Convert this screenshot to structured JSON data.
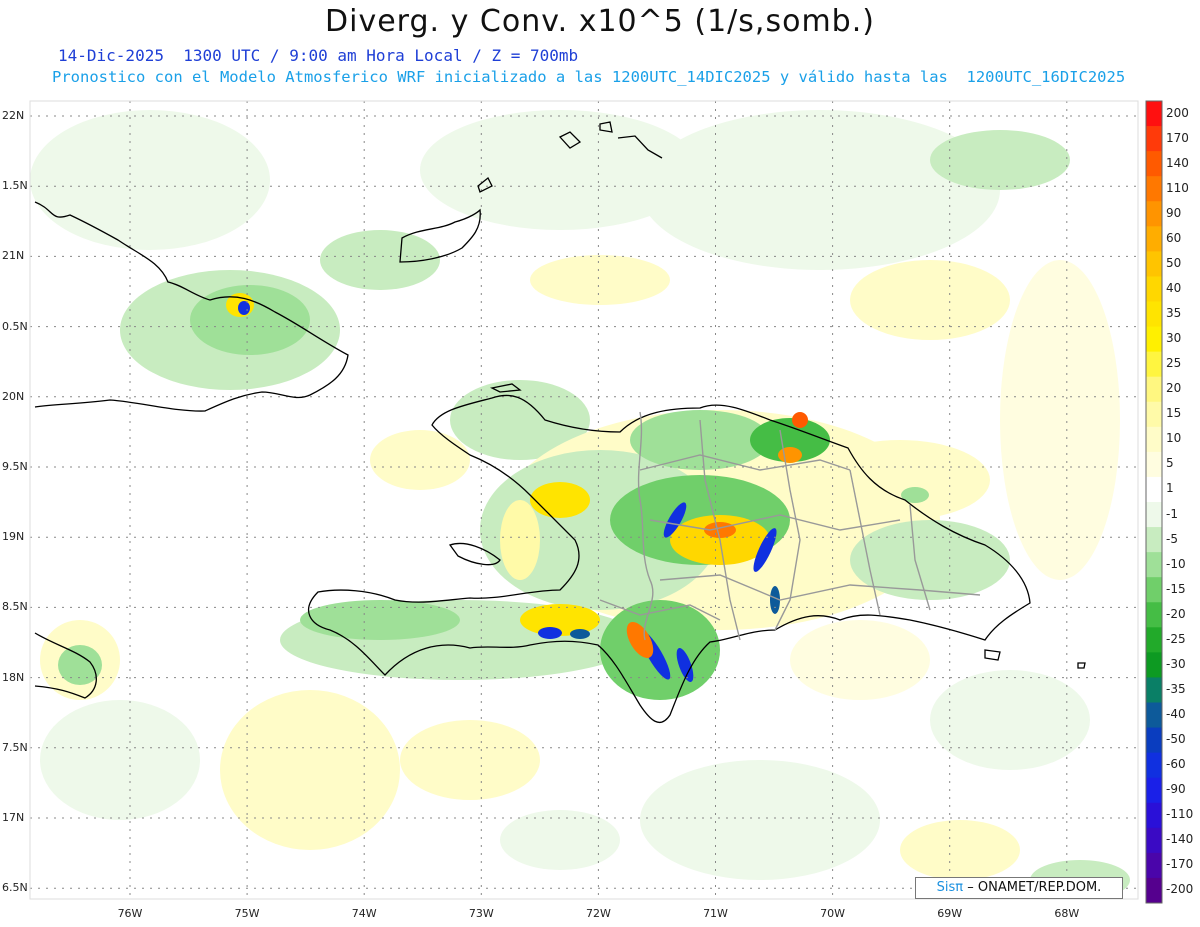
{
  "title": "Diverg. y Conv. x10^5 (1/s,somb.)",
  "subtitle_date": "14-Dic-2025  1300 UTC / 9:00 am Hora Local / Z = 700mb",
  "subtitle_model": "Pronostico con el Modelo Atmosferico WRF inicializado a las 1200UTC_14DIC2025 y válido hasta las  1200UTC_16DIC2025",
  "credit": {
    "brand": "Sisπ",
    "org": "– ONAMET/REP.DOM."
  },
  "lat_labels": [
    "22N",
    "1.5N",
    "21N",
    "0.5N",
    "20N",
    "9.5N",
    "19N",
    "8.5N",
    "18N",
    "7.5N",
    "17N",
    "6.5N"
  ],
  "lon_labels": [
    "76W",
    "75W",
    "74W",
    "73W",
    "72W",
    "71W",
    "70W",
    "69W",
    "68W"
  ],
  "colorbar": {
    "labels": [
      "200",
      "170",
      "140",
      "110",
      "90",
      "60",
      "50",
      "40",
      "35",
      "30",
      "25",
      "20",
      "15",
      "10",
      "5",
      "1",
      "-1",
      "-5",
      "-10",
      "-15",
      "-20",
      "-25",
      "-30",
      "-35",
      "-40",
      "-50",
      "-60",
      "-90",
      "-110",
      "-140",
      "-170",
      "-200"
    ],
    "colors": [
      "#ff1010",
      "#ff3a0a",
      "#ff5a00",
      "#ff7800",
      "#ff9400",
      "#ffad00",
      "#ffc400",
      "#ffd700",
      "#ffe400",
      "#fff000",
      "#fff540",
      "#fff780",
      "#fffaa8",
      "#fffcc8",
      "#fffde0",
      "#ffffff",
      "#eef9ea",
      "#c8ecc0",
      "#9fe098",
      "#70cf6a",
      "#45bd45",
      "#22aa2a",
      "#0d9a22",
      "#0a7f66",
      "#0d5a9a",
      "#0a3dbf",
      "#1030e0",
      "#1a20e8",
      "#2a10d8",
      "#3a0ac4",
      "#4a05aa",
      "#55008e"
    ]
  }
}
